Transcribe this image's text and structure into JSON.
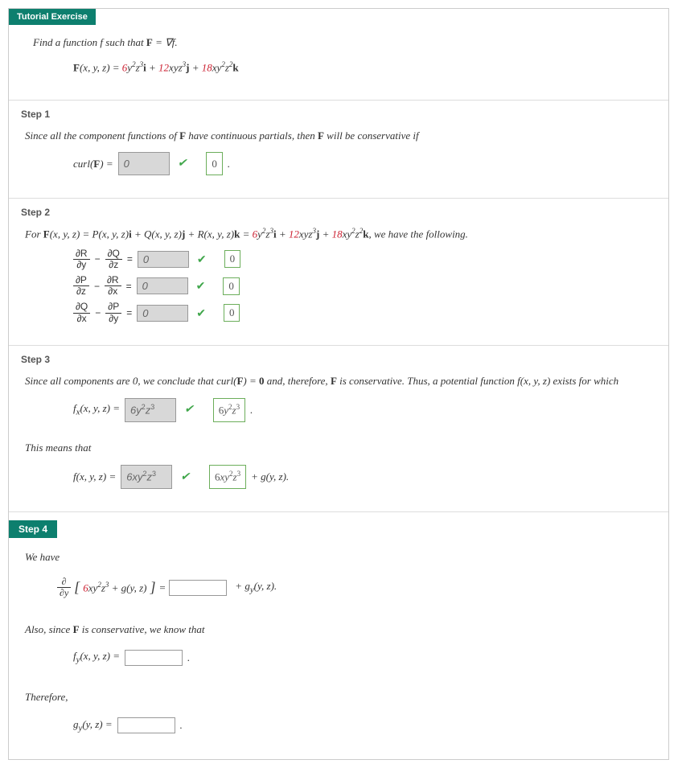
{
  "header": "Tutorial Exercise",
  "prompt": {
    "line1_pre": "Find a function ",
    "line1_f": "f",
    "line1_mid": " such that ",
    "line1_eq": "F = ∇f.",
    "formula_lhs": "F(x, y, z) = ",
    "term1": "6y²z³",
    "i": "i",
    "plus": " + ",
    "term2": "12xyz³",
    "j": "j",
    "term3": "18xy²z²",
    "k": "k"
  },
  "step1": {
    "title": "Step 1",
    "text_pre": "Since all the component functions of ",
    "F": "F",
    "text_mid": " have continuous partials, then ",
    "text_post": " will be conservative if",
    "curl_label": "curl(F) = ",
    "input_val": "0",
    "answer": "0"
  },
  "step2": {
    "title": "Step 2",
    "text_pre": "For  ",
    "eq_lhs": "F(x, y, z) = P(x, y, z)i + Q(x, y, z)j + R(x, y, z)k = ",
    "text_post": "  we have the following.",
    "rows": [
      {
        "l_num": "∂R",
        "l_den": "∂y",
        "r_num": "∂Q",
        "r_den": "∂z",
        "val": "0",
        "ans": "0"
      },
      {
        "l_num": "∂P",
        "l_den": "∂z",
        "r_num": "∂R",
        "r_den": "∂x",
        "val": "0",
        "ans": "0"
      },
      {
        "l_num": "∂Q",
        "l_den": "∂x",
        "r_num": "∂P",
        "r_den": "∂y",
        "val": "0",
        "ans": "0"
      }
    ]
  },
  "step3": {
    "title": "Step 3",
    "text1_pre": "Since all components are 0, we conclude that curl(",
    "F": "F",
    "text1_mid": ") = ",
    "zero": "0",
    "text1_mid2": " and, therefore, ",
    "text1_post": " is conservative. Thus, a potential function  ",
    "fxyz": "f(x, y, z)",
    "text1_end": "  exists for which",
    "fx_label": "fₓ(x, y, z) = ",
    "fx_input": "6y²z³",
    "fx_ans": "6y²z³",
    "means": "This means that",
    "f_label": "f(x, y, z) = ",
    "f_input": "6xy²z³",
    "f_ans": "6xy²z³",
    "f_tail": " + g(y, z)."
  },
  "step4": {
    "title": "Step 4",
    "wehave": "We have",
    "partial_expr": "6xy²z³ + g(y, z)",
    "eq": " = ",
    "tail1": " + gᵧ(y, z).",
    "also": "Also, since F is conservative, we know that",
    "fy_label": "fᵧ(x, y, z) = ",
    "therefore": "Therefore,",
    "gy_label": "gᵧ(y, z) = "
  }
}
